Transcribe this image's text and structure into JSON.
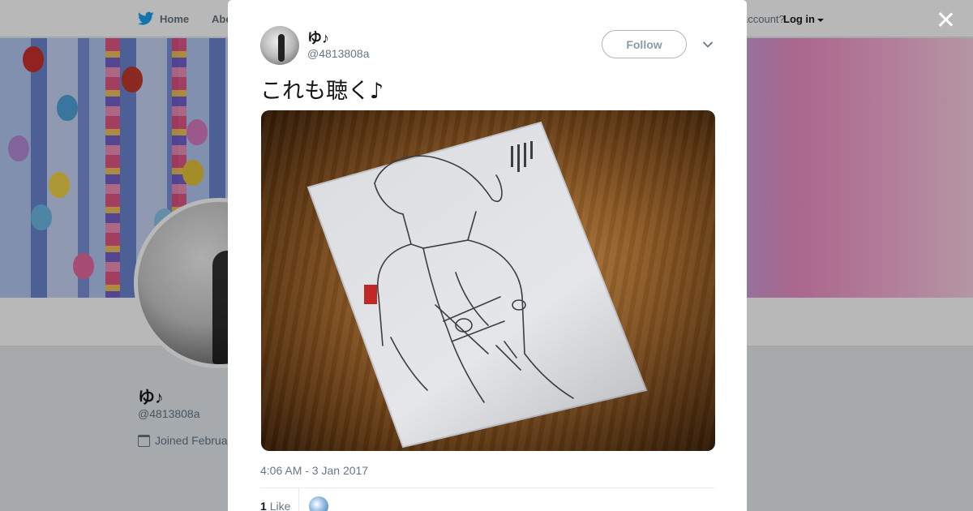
{
  "nav": {
    "home_label": "Home",
    "about_label": "Abo",
    "account_text": "account?",
    "login_label": "Log in"
  },
  "profile": {
    "name": "ゆ♪",
    "handle": "@4813808a",
    "joined_text": "Joined Februa"
  },
  "tweet": {
    "author_name": "ゆ♪",
    "author_handle": "@4813808a",
    "follow_label": "Follow",
    "text": "これも聴く♪",
    "timestamp": "4:06 AM - 3 Jan 2017",
    "like_count": "1",
    "like_label": "Like"
  },
  "colors": {
    "twitter_blue": "#1da1f2",
    "text_secondary": "#657786"
  }
}
